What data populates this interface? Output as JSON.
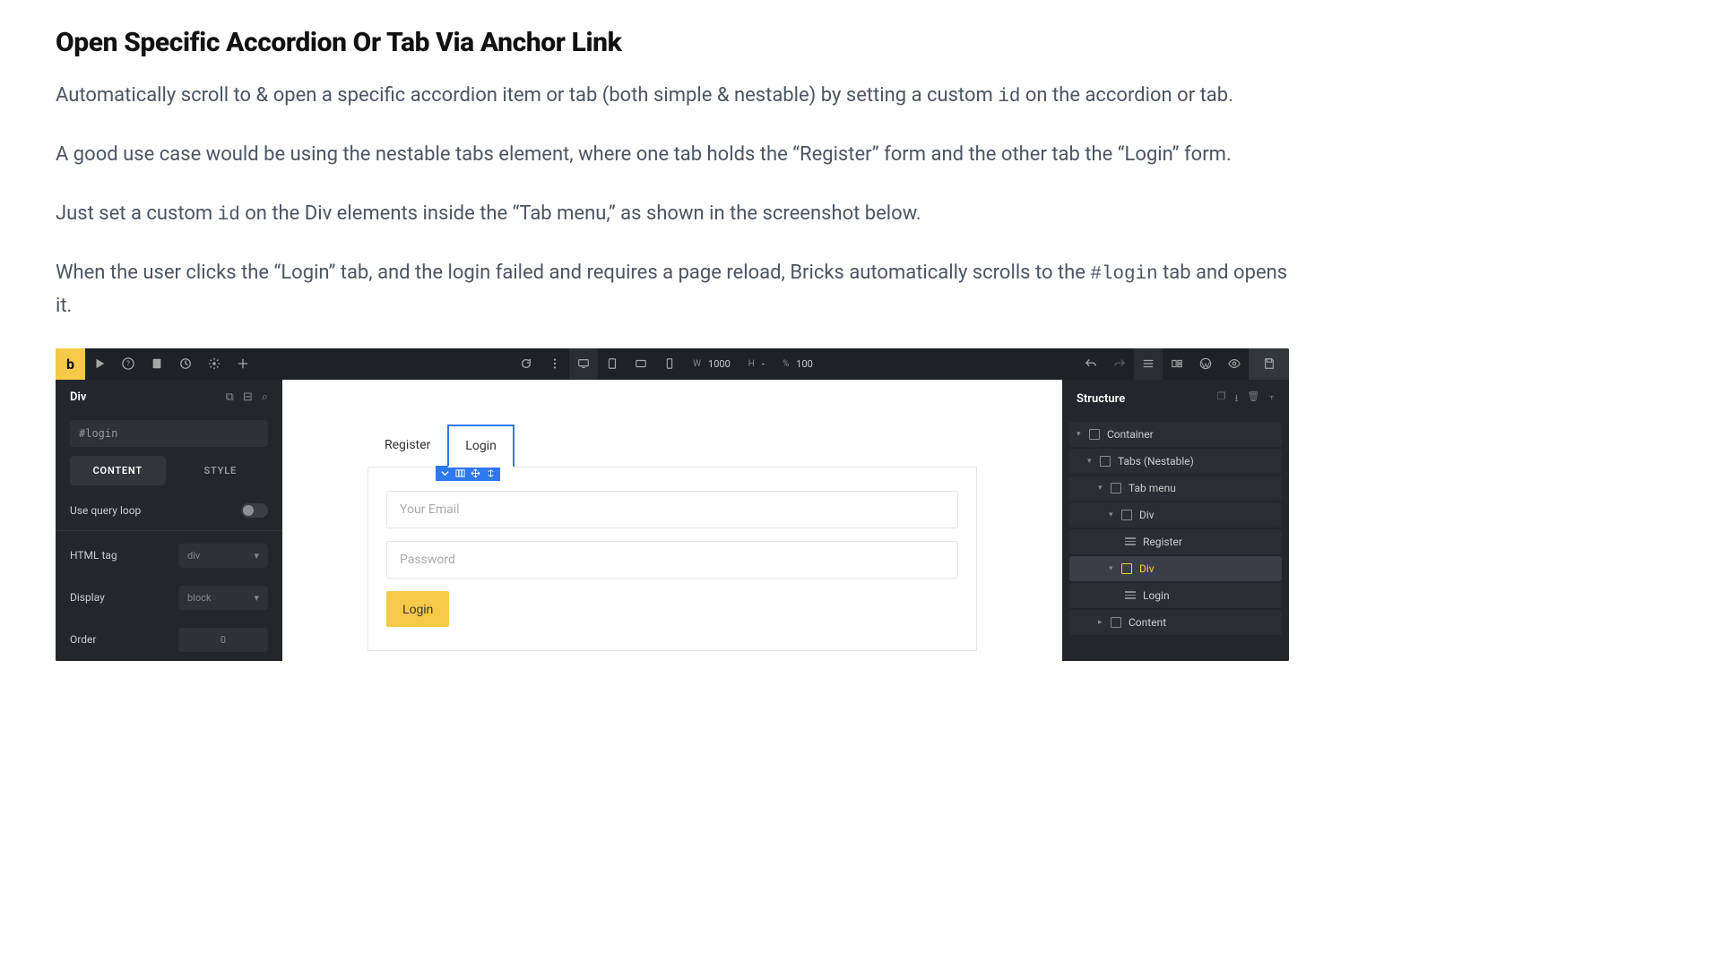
{
  "page": {
    "heading": "Open Specific Accordion Or Tab Via Anchor Link",
    "para1_a": "Automatically scroll to & open a specific accordion item or tab (both simple & nestable) by setting a custom ",
    "para1_code": "id",
    "para1_b": " on the accordion or tab.",
    "para2": "A good use case would be using the nestable tabs element, where one tab holds the “Register” form and the other tab the “Login” form.",
    "para3_a": "Just set a custom ",
    "para3_code": "id",
    "para3_b": " on the Div elements inside the “Tab menu,” as shown in the screenshot below.",
    "para4_a": "When the user clicks the “Login” tab, and the login failed and requires a page reload, Bricks automatically scrolls to the ",
    "para4_code": "#login",
    "para4_b": " tab and opens it."
  },
  "toolbar": {
    "logo": "b",
    "width_label": "W",
    "width_val": "1000",
    "height_label": "H",
    "height_val": "-",
    "percent_label": "%",
    "percent_val": "100"
  },
  "left": {
    "title": "Div",
    "id_value": "#login",
    "tab_content": "CONTENT",
    "tab_style": "STYLE",
    "query_loop": "Use query loop",
    "html_tag_label": "HTML tag",
    "html_tag_val": "div",
    "display_label": "Display",
    "display_val": "block",
    "order_label": "Order",
    "order_val": "0"
  },
  "canvas": {
    "tab_register": "Register",
    "tab_login": "Login",
    "email_placeholder": "Your Email",
    "password_placeholder": "Password",
    "login_btn": "Login"
  },
  "structure": {
    "title": "Structure",
    "items": {
      "container": "Container",
      "tabs": "Tabs (Nestable)",
      "tab_menu": "Tab menu",
      "div1": "Div",
      "register": "Register",
      "div2": "Div",
      "login": "Login",
      "content": "Content"
    }
  }
}
